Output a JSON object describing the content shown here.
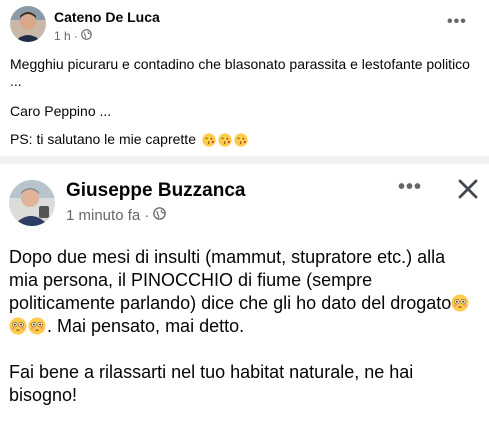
{
  "post1": {
    "author": "Cateno De Luca",
    "time": "1 h",
    "separator": "·",
    "audience_icon": "globe-icon",
    "more_icon": "more-dots-icon",
    "more_label": "•••",
    "line1": "Megghiu picuraru e contadino che blasonato parassita e lestofante politico ...",
    "line2": "Caro Peppino ...",
    "line3": "PS: ti salutano le mie caprette",
    "emoji_names": [
      "kissing-face-emoji",
      "kissing-face-emoji",
      "kissing-face-emoji"
    ]
  },
  "post2": {
    "author": "Giuseppe Buzzanca",
    "time": "1 minuto fa",
    "separator": "·",
    "audience_icon": "globe-icon",
    "more_label": "•••",
    "more_icon": "more-dots-icon",
    "close_icon": "close-icon",
    "para1_a": "Dopo due mesi di insulti (mammut, stupratore etc.) alla mia persona, il PINOCCHIO di fiume (sempre politicamente parlando) dice che gli ho dato del drogato",
    "para1_b": ". Mai pensato, mai detto.",
    "para2": "Fai bene a rilassarti nel tuo habitat naturale, ne hai bisogno!",
    "emoji_names": [
      "flushed-face-emoji",
      "flushed-face-emoji",
      "flushed-face-emoji"
    ]
  },
  "colors": {
    "text_primary": "#050505",
    "text_secondary": "#65676b",
    "divider": "#f0f2f5",
    "emoji_yellow": "#ffcc4d"
  }
}
